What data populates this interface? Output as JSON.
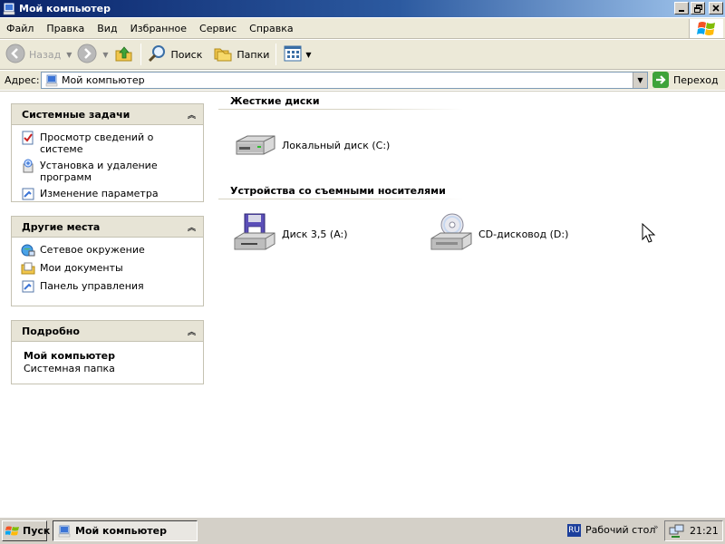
{
  "window": {
    "title": "Мой компьютер"
  },
  "menu": [
    "Файл",
    "Правка",
    "Вид",
    "Избранное",
    "Сервис",
    "Справка"
  ],
  "toolbar": {
    "back_label": "Назад",
    "search_label": "Поиск",
    "folders_label": "Папки"
  },
  "address": {
    "label": "Адрес:",
    "value": "Мой компьютер",
    "go_label": "Переход"
  },
  "taskpane": {
    "system_tasks": {
      "title": "Системные задачи",
      "items": [
        "Просмотр сведений о системе",
        "Установка и удаление программ",
        "Изменение параметра"
      ]
    },
    "other_places": {
      "title": "Другие места",
      "items": [
        "Сетевое окружение",
        "Мои документы",
        "Панель управления"
      ]
    },
    "details": {
      "title": "Подробно",
      "name": "Мой компьютер",
      "type": "Системная папка"
    }
  },
  "groups": {
    "hard_disks": {
      "header": "Жесткие диски",
      "items": [
        "Локальный диск (C:)"
      ]
    },
    "removable": {
      "header": "Устройства со съемными носителями",
      "items": [
        "Диск 3,5 (A:)",
        "CD-дисковод (D:)"
      ]
    }
  },
  "taskbar": {
    "start_label": "Пуск",
    "task_label": "Мой компьютер",
    "lang": "RU",
    "desktop_label": "Рабочий стол",
    "clock": "21:21"
  },
  "colors": {
    "titlebar_start": "#0a246a",
    "titlebar_end": "#a6caf0",
    "chrome": "#ece9d8",
    "panel_header": "#e7e4d6"
  },
  "icons": {
    "back": "back-arrow-icon",
    "forward": "forward-arrow-icon",
    "up": "up-folder-icon",
    "search": "magnifier-icon",
    "folders": "folders-icon",
    "views": "views-icon",
    "go": "go-arrow-icon"
  }
}
